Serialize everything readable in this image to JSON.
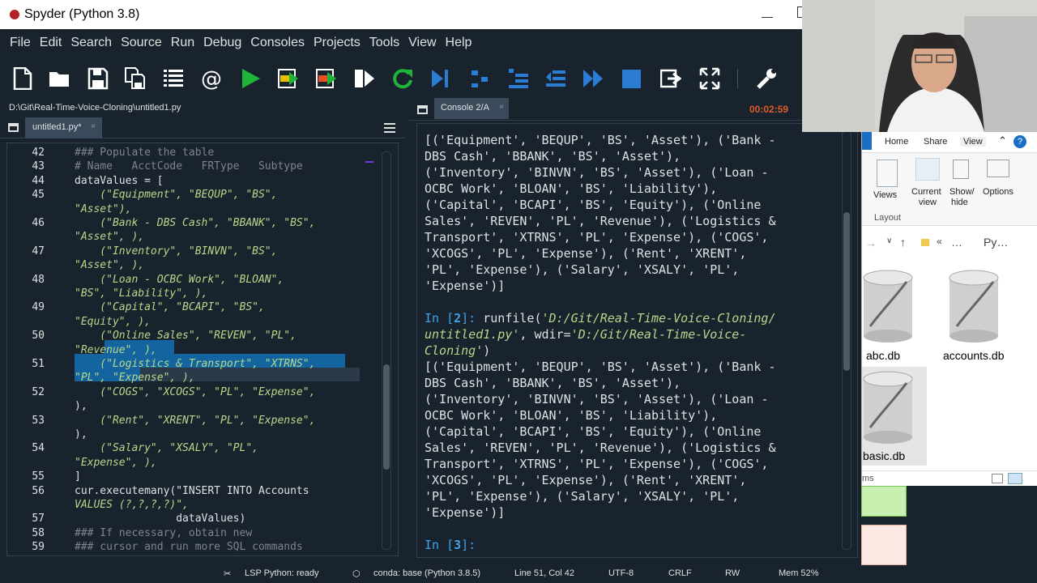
{
  "window": {
    "title": "Spyder (Python 3.8)"
  },
  "menubar": [
    "File",
    "Edit",
    "Search",
    "Source",
    "Run",
    "Debug",
    "Consoles",
    "Projects",
    "Tools",
    "View",
    "Help"
  ],
  "toolbar": {
    "icons": [
      "new-file-icon",
      "open-folder-icon",
      "save-icon",
      "save-all-icon",
      "outline-icon",
      "at-icon",
      "run-icon",
      "run-cell-icon",
      "run-cell-advance-icon",
      "run-selection-icon",
      "rerun-icon",
      "debug-step-icon",
      "continue-icon",
      "step-into-icon",
      "step-return-icon",
      "continue-execution-icon",
      "stop-icon",
      "exit-debug-icon",
      "fullscreen-icon",
      "preferences-icon"
    ]
  },
  "editor": {
    "path": "D:\\Git\\Real-Time-Voice-Cloning\\untitled1.py",
    "tab_label": "untitled1.py*",
    "tab_close": "×",
    "lines": [
      {
        "n": "42",
        "text": "### Populate the table",
        "kind": "cm"
      },
      {
        "n": "43",
        "text": "# Name   AcctCode   FRType   Subtype",
        "kind": "cm"
      },
      {
        "n": "44",
        "text": "dataValues = [",
        "kind": "code"
      },
      {
        "n": "45",
        "text": "    (\"Equipment\", \"BEQUP\", \"BS\",",
        "kind": "str"
      },
      {
        "n": "",
        "text": "\"Asset\"),",
        "kind": "str"
      },
      {
        "n": "46",
        "text": "    (\"Bank - DBS Cash\", \"BBANK\", \"BS\",",
        "kind": "str"
      },
      {
        "n": "",
        "text": "\"Asset\", ),",
        "kind": "str"
      },
      {
        "n": "47",
        "text": "    (\"Inventory\", \"BINVN\", \"BS\",",
        "kind": "str"
      },
      {
        "n": "",
        "text": "\"Asset\", ),",
        "kind": "str"
      },
      {
        "n": "48",
        "text": "    (\"Loan - OCBC Work\", \"BLOAN\",",
        "kind": "str"
      },
      {
        "n": "",
        "text": "\"BS\", \"Liability\", ),",
        "kind": "str"
      },
      {
        "n": "49",
        "text": "    (\"Capital\", \"BCAPI\", \"BS\",",
        "kind": "str"
      },
      {
        "n": "",
        "text": "\"Equity\", ),",
        "kind": "str"
      },
      {
        "n": "50",
        "text": "    (\"Online Sales\", \"REVEN\", \"PL\",",
        "kind": "str"
      },
      {
        "n": "",
        "text": "\"Revenue\", ),",
        "kind": "str"
      },
      {
        "n": "51",
        "text": "    (\"Logistics & Transport\", \"XTRNS\",",
        "kind": "str"
      },
      {
        "n": "",
        "text": "\"PL\", \"Expense\", ),",
        "kind": "str"
      },
      {
        "n": "52",
        "text": "    (\"COGS\", \"XCOGS\", \"PL\", \"Expense\",",
        "kind": "str"
      },
      {
        "n": "",
        "text": "),",
        "kind": "code"
      },
      {
        "n": "53",
        "text": "    (\"Rent\", \"XRENT\", \"PL\", \"Expense\",",
        "kind": "str"
      },
      {
        "n": "",
        "text": "),",
        "kind": "code"
      },
      {
        "n": "54",
        "text": "    (\"Salary\", \"XSALY\", \"PL\",",
        "kind": "str"
      },
      {
        "n": "",
        "text": "\"Expense\", ),",
        "kind": "str"
      },
      {
        "n": "55",
        "text": "]",
        "kind": "code"
      },
      {
        "n": "56",
        "text": "cur.executemany(\"INSERT INTO Accounts",
        "kind": "mixed"
      },
      {
        "n": "",
        "text": "VALUES (?,?,?,?)\",",
        "kind": "str"
      },
      {
        "n": "57",
        "text": "                dataValues)",
        "kind": "code"
      },
      {
        "n": "58",
        "text": "### If necessary, obtain new",
        "kind": "cm"
      },
      {
        "n": "59",
        "text": "### cursor and run more SQL commands",
        "kind": "cm"
      }
    ]
  },
  "console": {
    "tab_label": "Console 2/A",
    "tab_close": "×",
    "timer": "00:02:59",
    "lines": [
      {
        "t": "out",
        "text": "[('Equipment', 'BEQUP', 'BS', 'Asset'), ('Bank -"
      },
      {
        "t": "out",
        "text": "DBS Cash', 'BBANK', 'BS', 'Asset'),"
      },
      {
        "t": "out",
        "text": "('Inventory', 'BINVN', 'BS', 'Asset'), ('Loan -"
      },
      {
        "t": "out",
        "text": "OCBC Work', 'BLOAN', 'BS', 'Liability'),"
      },
      {
        "t": "out",
        "text": "('Capital', 'BCAPI', 'BS', 'Equity'), ('Online"
      },
      {
        "t": "out",
        "text": "Sales', 'REVEN', 'PL', 'Revenue'), ('Logistics &"
      },
      {
        "t": "out",
        "text": "Transport', 'XTRNS', 'PL', 'Expense'), ('COGS',"
      },
      {
        "t": "out",
        "text": "'XCOGS', 'PL', 'Expense'), ('Rent', 'XRENT',"
      },
      {
        "t": "out",
        "text": "'PL', 'Expense'), ('Salary', 'XSALY', 'PL',"
      },
      {
        "t": "out",
        "text": "'Expense')]"
      },
      {
        "t": "blank",
        "text": ""
      },
      {
        "t": "cmd1",
        "prompt": "In [",
        "num": "2",
        "prompt_end": "]: ",
        "fn": "runfile(",
        "arg": "'D:/Git/Real-Time-Voice-Cloning/"
      },
      {
        "t": "cmd2",
        "arg": "untitled1.py'",
        "mid": ", wdir=",
        "arg2": "'D:/Git/Real-Time-Voice-"
      },
      {
        "t": "cmd3",
        "arg": "Cloning'",
        "tail": ")"
      },
      {
        "t": "out",
        "text": "[('Equipment', 'BEQUP', 'BS', 'Asset'), ('Bank -"
      },
      {
        "t": "out",
        "text": "DBS Cash', 'BBANK', 'BS', 'Asset'),"
      },
      {
        "t": "out",
        "text": "('Inventory', 'BINVN', 'BS', 'Asset'), ('Loan -"
      },
      {
        "t": "out",
        "text": "OCBC Work', 'BLOAN', 'BS', 'Liability'),"
      },
      {
        "t": "out",
        "text": "('Capital', 'BCAPI', 'BS', 'Equity'), ('Online"
      },
      {
        "t": "out",
        "text": "Sales', 'REVEN', 'PL', 'Revenue'), ('Logistics &"
      },
      {
        "t": "out",
        "text": "Transport', 'XTRNS', 'PL', 'Expense'), ('COGS',"
      },
      {
        "t": "out",
        "text": "'XCOGS', 'PL', 'Expense'), ('Rent', 'XRENT',"
      },
      {
        "t": "out",
        "text": "'PL', 'Expense'), ('Salary', 'XSALY', 'PL',"
      },
      {
        "t": "out",
        "text": "'Expense')]"
      },
      {
        "t": "blank",
        "text": ""
      },
      {
        "t": "prompt",
        "prompt": "In [",
        "num": "3",
        "prompt_end": "]: "
      }
    ]
  },
  "statusbar": {
    "lsp": "LSP Python: ready",
    "conda": "conda: base (Python 3.8.5)",
    "position": "Line 51, Col 42",
    "encoding": "UTF-8",
    "eol": "CRLF",
    "rw": "RW",
    "mem": "Mem 52%"
  },
  "explorer": {
    "tabs": [
      "Home",
      "Share",
      "View"
    ],
    "ribbon": {
      "views": "Views",
      "current_view_1": "Current",
      "current_view_2": "view",
      "show_hide_1": "Show/",
      "show_hide_2": "hide",
      "options": "Options",
      "group": "Layout"
    },
    "address": {
      "ellipsis": "…",
      "folder": "Py…",
      "chev": "«"
    },
    "files": [
      "abc.db",
      "accounts.db",
      "basic.db"
    ],
    "bottom_text": "ms"
  },
  "colors": {
    "background": "#19232d",
    "selection": "#1464a0",
    "prompt": "#41a2e8",
    "string": "#b5d98a",
    "timer": "#e05a2a"
  }
}
